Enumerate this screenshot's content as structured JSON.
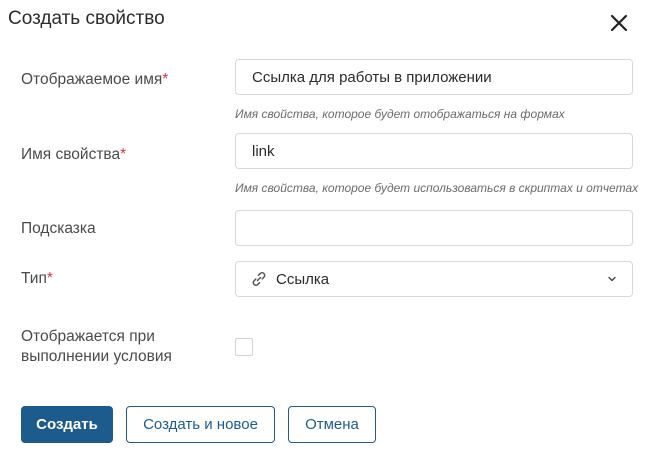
{
  "dialog": {
    "title": "Создать свойство",
    "close_icon": "close-icon"
  },
  "form": {
    "display_name": {
      "label": "Отображаемое имя",
      "required_mark": "*",
      "value": "Ссылка для работы в приложении",
      "hint": "Имя свойства, которое будет отображаться на формах"
    },
    "property_name": {
      "label": "Имя свойства",
      "required_mark": "*",
      "value": "link",
      "hint": "Имя свойства, которое будет использоваться в скриптах и отчетах"
    },
    "tooltip": {
      "label": "Подсказка",
      "value": ""
    },
    "type": {
      "label": "Тип",
      "required_mark": "*",
      "selected": "Ссылка",
      "icon": "link-icon"
    },
    "conditional": {
      "label_line1": "Отображается при",
      "label_line2": "выполнении условия",
      "checked": false
    }
  },
  "buttons": {
    "create": "Создать",
    "create_and_new": "Создать и новое",
    "cancel": "Отмена"
  },
  "colors": {
    "primary": "#1e5b8d",
    "required": "#d9363e",
    "border": "#d6d9dc"
  }
}
